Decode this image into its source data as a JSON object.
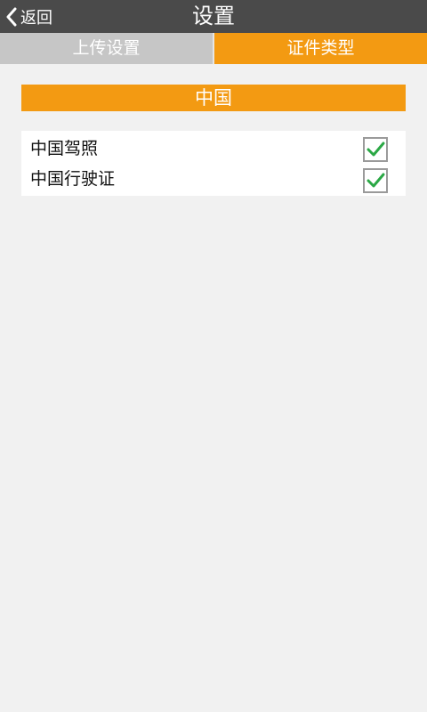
{
  "header": {
    "back_label": "返回",
    "title": "设置"
  },
  "tabs": [
    {
      "label": "上传设置",
      "active": false
    },
    {
      "label": "证件类型",
      "active": true
    }
  ],
  "section": {
    "title": "中国"
  },
  "cert_types": [
    {
      "label": "中国驾照",
      "checked": true
    },
    {
      "label": "中国行驶证",
      "checked": true
    }
  ],
  "colors": {
    "title_bar": "#4a4a4a",
    "accent": "#f39a12",
    "inactive_tab": "#c6c6c6",
    "check": "#2aa845"
  },
  "icons": {
    "back": "chevron-left-icon",
    "check": "checkmark-icon"
  }
}
